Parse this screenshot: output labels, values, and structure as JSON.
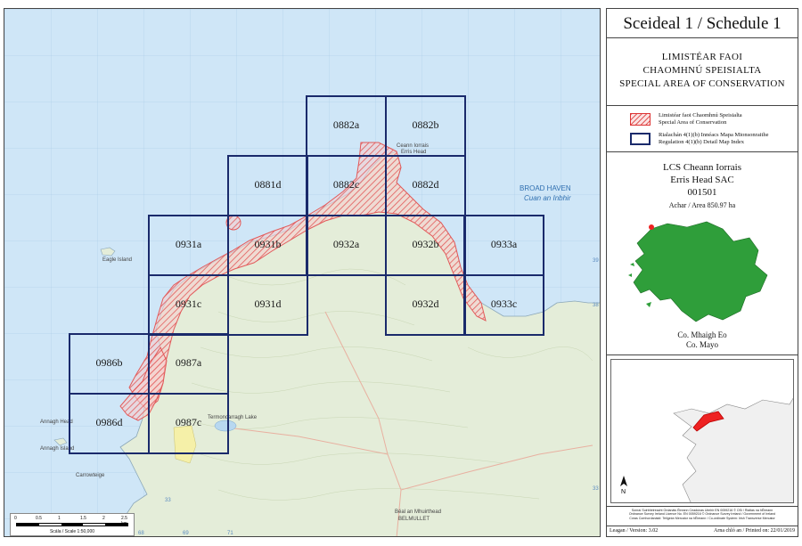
{
  "schedule": {
    "title": "Sceideal 1 / Schedule 1"
  },
  "designation": {
    "line1": "LIMISTÉAR FAOI",
    "line2": "CHAOMHNÚ SPEISIALTA",
    "line3": "SPECIAL AREA OF CONSERVATION"
  },
  "legend": {
    "sac": {
      "line1": "Limistéar faoi Chaomhnú Speisialta",
      "line2": "Special Area of Conservation",
      "color": "#e25a5a"
    },
    "index": {
      "line1": "Rialachán 4(1)(b) Innéacs Mapa Mionsonraithe",
      "line2": "Regulation 4(1)(b) Detail Map Index",
      "color": "#1a2a6b"
    }
  },
  "site": {
    "name_ga": "LCS Cheann Iorrais",
    "name_en": "Erris Head SAC",
    "code": "001501",
    "area": "Achar / Area 850.97 ha"
  },
  "county": {
    "ga": "Co. Mhaigh Eo",
    "en": "Co. Mayo"
  },
  "map_tiles": [
    "0882a",
    "0882b",
    "0881d",
    "0882c",
    "0882d",
    "0931a",
    "0931b",
    "0932a",
    "0932b",
    "0933a",
    "0931c",
    "0931d",
    "0932d",
    "0933c",
    "0986b",
    "0987a",
    "0986d",
    "0987c"
  ],
  "place_labels": {
    "erris_head_ga": "Ceann Iorrais",
    "erris_head_en": "Erris Head",
    "broad_haven_en": "BROAD HAVEN",
    "broad_haven_ga": "Cuan an Inbhir",
    "eagle_island": "Eagle Island",
    "belmullet_ga": "Béal an Mhuirthead",
    "belmullet_en": "BELMULLET",
    "annagh_head": "Annagh Head",
    "annagh_island": "Annagh Island",
    "carrowteige": "Carrowteige",
    "lake": "Termoncarragh Lake"
  },
  "scale": {
    "ticks": [
      "0",
      "0.5",
      "1",
      "1.5",
      "2",
      "2.5 km"
    ],
    "label": "Scála / Scale 1:50,000"
  },
  "copyright": {
    "line1": "Sonraí Suirbhéireacht Ordanáis Éireann Ceadúnas Uimhir EN 0059216 © OSi / Rialtas na hÉireann",
    "line2": "Ordnance Survey Ireland Licence No. EN 0059216 © Ordnance Survey Ireland / Government of Ireland",
    "line3": "Córas Comhordanáidí: Teilgeán Mercator na hÉireann / Co-ordinate System: Irish Transverse Mercator"
  },
  "footer": {
    "version": "Leagan / Version: 3.02",
    "printed": "Arna chló an / Printed on: 22/01/2019"
  },
  "colors": {
    "sea": "#cfe6f7",
    "land": "#e4edd9",
    "sac_hatch": "#e25a5a",
    "tile_border": "#1a2a6b"
  }
}
